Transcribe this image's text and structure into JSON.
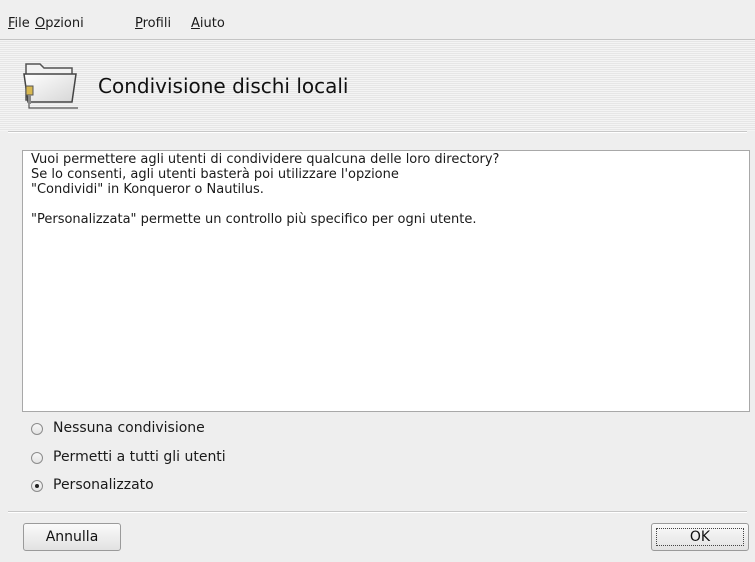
{
  "menubar": {
    "items": [
      {
        "label": "File",
        "mnemonic": "F",
        "rest": "ile"
      },
      {
        "label": "Opzioni",
        "mnemonic": "O",
        "rest": "pzioni"
      },
      {
        "label": "Profili",
        "mnemonic": "P",
        "rest": "rofili"
      },
      {
        "label": "Aiuto",
        "mnemonic": "A",
        "rest": "iuto"
      }
    ]
  },
  "header": {
    "icon": "folder-share-icon",
    "title": "Condivisione dischi locali"
  },
  "description": "Vuoi permettere agli utenti di condividere qualcuna delle loro directory?\nSe lo consenti, agli utenti basterà poi utilizzare l'opzione\n\"Condividi\" in Konqueror o Nautilus.\n\n\"Personalizzata\" permette un controllo più specifico per ogni utente.",
  "options": [
    {
      "label": "Nessuna condivisione",
      "selected": false
    },
    {
      "label": "Permetti a tutti gli utenti",
      "selected": false
    },
    {
      "label": "Personalizzato",
      "selected": true
    }
  ],
  "buttons": {
    "cancel": "Annulla",
    "ok": "OK"
  }
}
